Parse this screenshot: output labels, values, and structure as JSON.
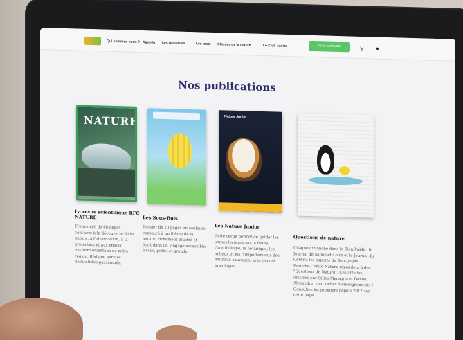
{
  "nav": {
    "items": [
      "Qui sommes-nous ?",
      "Agenda",
      "Les Nouvelles",
      "Les tests",
      "Classes de la nature",
      "Le Club Junior"
    ],
    "cta": "Nous contacter",
    "icons": [
      "search-icon",
      "user-icon"
    ]
  },
  "page": {
    "title": "Nos publications"
  },
  "covers": {
    "nature_mast": "NATURE",
    "junior_mast": "Nature Junior"
  },
  "publications": [
    {
      "title": "La revue scientifique RFC NATURE",
      "text": "Trimestriel de 68 pages consacré à la découverte de la nature, à l'observation, à la protection et aux enjeux environnementaux de notre région. Rédigée par des naturalistes passionnés."
    },
    {
      "title": "Les Sous-Bois",
      "text": "Dossier de 20 pages en couleurs consacré à un thème de la nature, richement illustré et écrit dans un langage accessible à tous, petits et grands."
    },
    {
      "title": "Les Nature Junior",
      "text": "Cette revue permet de guider les jeunes lecteurs sur la faune, l'ornithologie, la botanique, les milieux et les comportements des animaux sauvages, avec jeux et bricolages."
    },
    {
      "title": "Questions de nature",
      "text": "Chaque dimanche dans le Bien Public, le Journal de Saône-et-Loire et le Journal du Centre, les experts de Bourgogne Franche-Comté Nature répondent à des \"Questions de Nature\". Ces articles, illustrés par Gilles Macagno et Daniel Alexandre, sont riches d'enseignements ! Consultez les premiers depuis 2012 sur cette page !"
    }
  ]
}
